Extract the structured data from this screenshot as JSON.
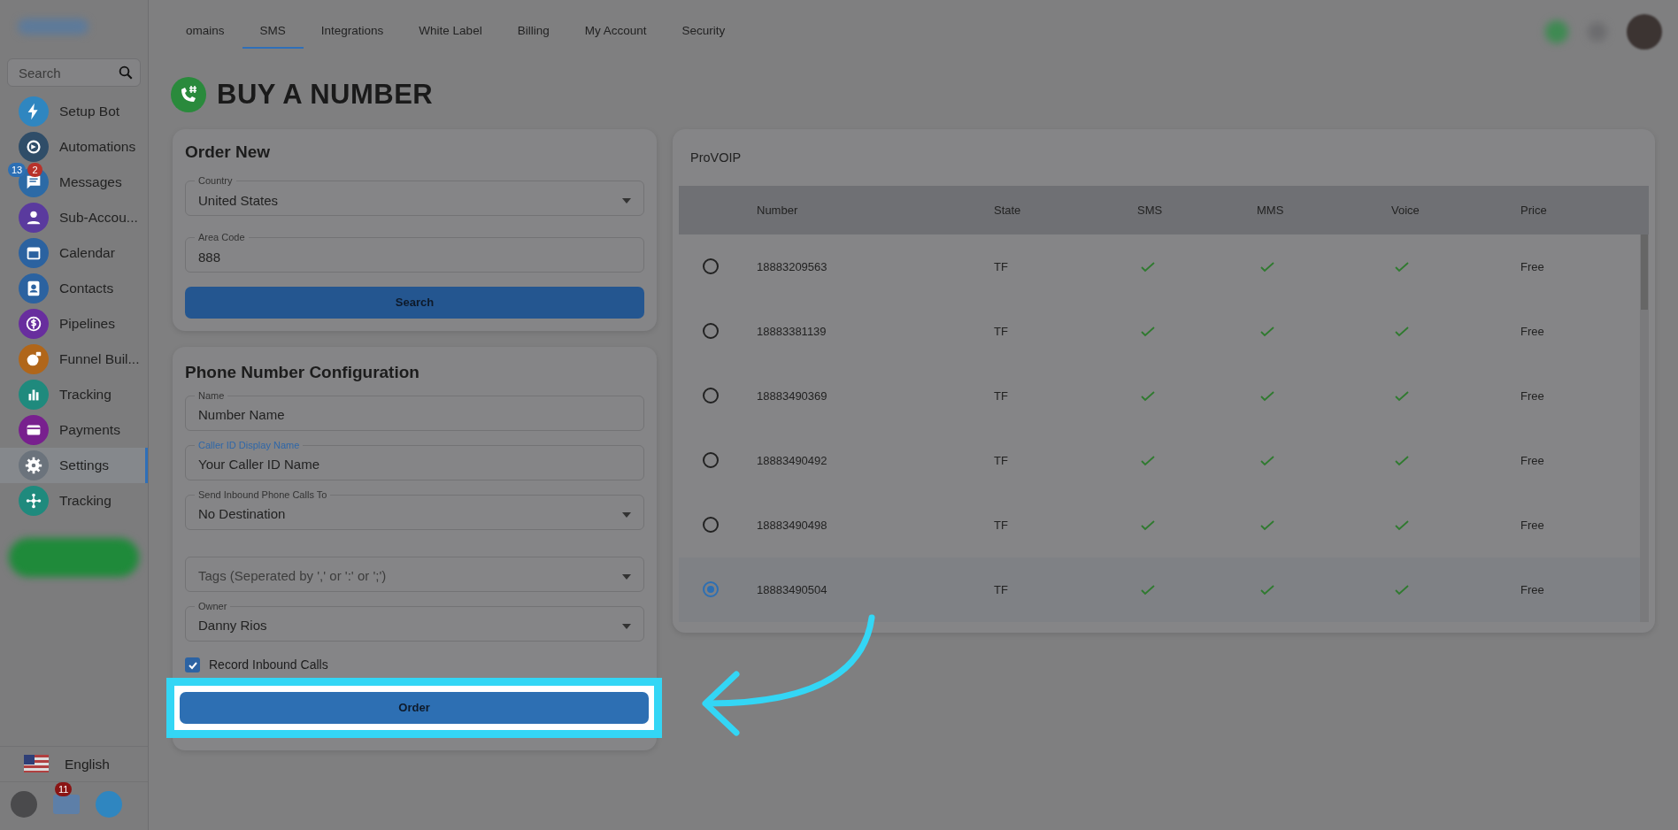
{
  "sidebar": {
    "search": {
      "placeholder": "Search"
    },
    "items": [
      {
        "label": "Setup Bot",
        "color": "#2f86c0",
        "selected": false
      },
      {
        "label": "Automations",
        "color": "#2f4d68",
        "selected": false
      },
      {
        "label": "Messages",
        "color": "#2c6aa6",
        "selected": false,
        "badges": [
          {
            "text": "13",
            "color": "#2c6fb4"
          },
          {
            "text": "2",
            "color": "#b8322a"
          }
        ]
      },
      {
        "label": "Sub-Accou...",
        "color": "#5a3a9e",
        "selected": false
      },
      {
        "label": "Calendar",
        "color": "#2b62a0",
        "selected": false
      },
      {
        "label": "Contacts",
        "color": "#2b62a0",
        "selected": false
      },
      {
        "label": "Pipelines",
        "color": "#682e9e",
        "selected": false
      },
      {
        "label": "Funnel Buil...",
        "color": "#b0661a",
        "selected": false
      },
      {
        "label": "Tracking",
        "color": "#1f8a7d",
        "selected": false
      },
      {
        "label": "Payments",
        "color": "#78208e",
        "selected": false
      },
      {
        "label": "Settings",
        "color": "#6b737c",
        "selected": true
      },
      {
        "label": "Tracking",
        "color": "#1f8a7d",
        "selected": false
      }
    ],
    "language": "English",
    "bottom_badge": "11"
  },
  "top_nav": {
    "tabs": [
      {
        "label": "omains",
        "selected": false
      },
      {
        "label": "SMS",
        "selected": true
      },
      {
        "label": "Integrations",
        "selected": false
      },
      {
        "label": "White Label",
        "selected": false
      },
      {
        "label": "Billing",
        "selected": false
      },
      {
        "label": "My Account",
        "selected": false
      },
      {
        "label": "Security",
        "selected": false
      }
    ]
  },
  "page_title": "BUY A NUMBER",
  "order_new": {
    "title": "Order New",
    "fields": [
      {
        "kind": "select",
        "label": "Country",
        "value": "United States"
      },
      {
        "kind": "text",
        "label": "Area Code",
        "value": "888"
      }
    ],
    "button": "Search"
  },
  "config": {
    "title": "Phone Number Configuration",
    "fields": [
      {
        "kind": "text",
        "label": "Name",
        "value": "Number Name",
        "focused": false
      },
      {
        "kind": "text",
        "label": "Caller ID Display Name",
        "value": "Your Caller ID Name",
        "focused": true
      },
      {
        "kind": "select",
        "label": "Send Inbound Phone Calls To",
        "value": "No Destination",
        "focused": false
      },
      {
        "kind": "select",
        "placeholder": "Tags (Seperated by ',' or ':' or ';')"
      },
      {
        "kind": "select",
        "label": "Owner",
        "value": "Danny Rios",
        "focused": false
      }
    ],
    "checkbox": {
      "label": "Record Inbound Calls",
      "checked": true
    },
    "button": "Order",
    "highlighted": true
  },
  "provider": {
    "title": "ProVOIP",
    "columns": [
      "Number",
      "State",
      "SMS",
      "MMS",
      "Voice",
      "Price"
    ],
    "rows": [
      {
        "selected": false,
        "number": "18883209563",
        "state": "TF",
        "sms": true,
        "mms": true,
        "voice": true,
        "price": "Free"
      },
      {
        "selected": false,
        "number": "18883381139",
        "state": "TF",
        "sms": true,
        "mms": true,
        "voice": true,
        "price": "Free"
      },
      {
        "selected": false,
        "number": "18883490369",
        "state": "TF",
        "sms": true,
        "mms": true,
        "voice": true,
        "price": "Free"
      },
      {
        "selected": false,
        "number": "18883490492",
        "state": "TF",
        "sms": true,
        "mms": true,
        "voice": true,
        "price": "Free"
      },
      {
        "selected": false,
        "number": "18883490498",
        "state": "TF",
        "sms": true,
        "mms": true,
        "voice": true,
        "price": "Free"
      },
      {
        "selected": true,
        "number": "18883490504",
        "state": "TF",
        "sms": true,
        "mms": true,
        "voice": true,
        "price": "Free"
      }
    ]
  }
}
